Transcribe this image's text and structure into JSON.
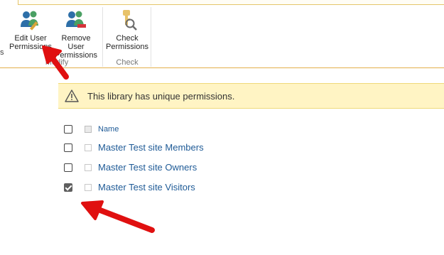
{
  "ribbon": {
    "buttons": [
      {
        "label_line1": "Edit User",
        "label_line2": "Permissions",
        "icon": "edit-user-permissions-icon"
      },
      {
        "label_line1": "Remove User",
        "label_line2": "Permissions",
        "icon": "remove-user-permissions-icon"
      },
      {
        "label_line1": "Check",
        "label_line2": "Permissions",
        "icon": "check-permissions-icon"
      }
    ],
    "groups": [
      {
        "label": "Modify"
      },
      {
        "label": "Check"
      }
    ],
    "cut_label": "s"
  },
  "banner": {
    "icon": "warning-icon",
    "message": "This library has unique permissions."
  },
  "list": {
    "header": {
      "name": "Name",
      "checked": false
    },
    "rows": [
      {
        "name": "Master Test site Members",
        "checked": false
      },
      {
        "name": "Master Test site Owners",
        "checked": false
      },
      {
        "name": "Master Test site Visitors",
        "checked": true
      }
    ]
  },
  "colors": {
    "link": "#1e5a96",
    "banner_bg": "#fff4c4",
    "ribbon_border": "#e3b04b",
    "annotation_arrow": "#e01010"
  }
}
